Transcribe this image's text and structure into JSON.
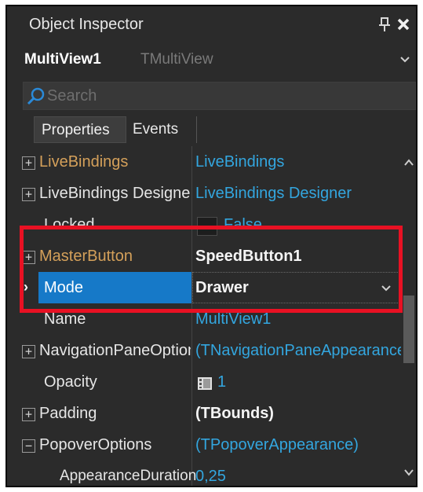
{
  "window": {
    "title": "Object Inspector",
    "pin_icon": "pin-icon",
    "close_icon": "close-icon"
  },
  "object_selector": {
    "name": "MultiView1",
    "type": "TMultiView"
  },
  "search": {
    "placeholder": "Search",
    "value": ""
  },
  "tabs": [
    {
      "label": "Properties",
      "active": true
    },
    {
      "label": "Events",
      "active": false
    }
  ],
  "properties": [
    {
      "name": "LiveBindings",
      "value": "LiveBindings",
      "expander": "+"
    },
    {
      "name": "LiveBindings Designer",
      "value": "LiveBindings Designer",
      "expander": "+"
    },
    {
      "name": "Locked",
      "value": "False"
    },
    {
      "name": "MasterButton",
      "value": "SpeedButton1",
      "expander": "+"
    },
    {
      "name": "Mode",
      "value": "Drawer",
      "selected": true
    },
    {
      "name": "Name",
      "value": "MultiView1"
    },
    {
      "name": "NavigationPaneOptions",
      "value": "(TNavigationPaneAppearance)",
      "expander": "+"
    },
    {
      "name": "Opacity",
      "value": "1"
    },
    {
      "name": "Padding",
      "value": "(TBounds)",
      "expander": "+"
    },
    {
      "name": "PopoverOptions",
      "value": "(TPopoverAppearance)",
      "expander": "−"
    },
    {
      "name": "AppearanceDuration",
      "value": "0,25"
    }
  ],
  "colors": {
    "background": "#2b2b2b",
    "selection": "#1679c8",
    "link": "#33a6df",
    "reference_property": "#d4a05a",
    "highlight": "#e81123"
  }
}
